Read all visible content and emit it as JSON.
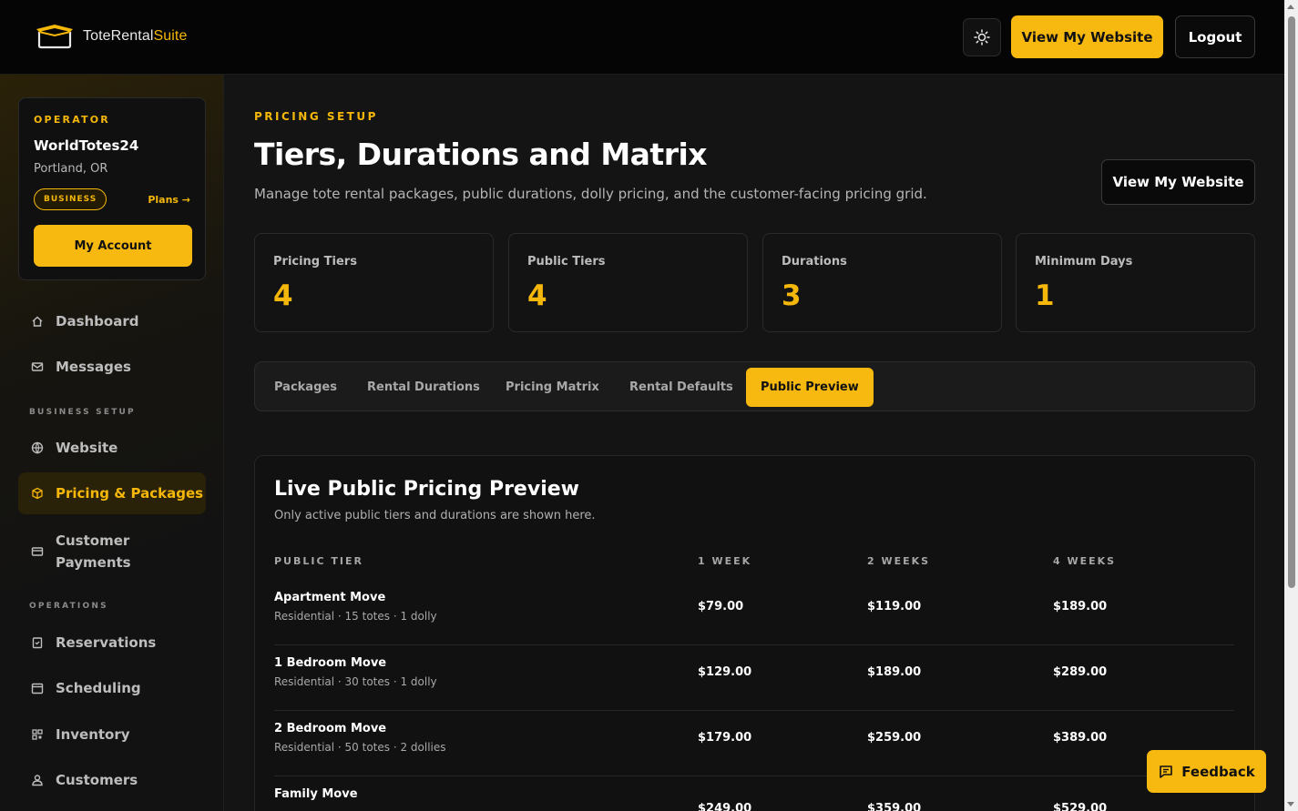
{
  "app": {
    "logo_text": "ToteRental",
    "logo_text_suite": "Suite"
  },
  "header": {
    "view_website": "View My Website",
    "logout": "Logout"
  },
  "operator": {
    "label": "OPERATOR",
    "name": "WorldTotes24",
    "location": "Portland, OR",
    "badge": "BUSINESS",
    "plans": "Plans →",
    "account_button": "My Account"
  },
  "nav": {
    "dashboard": "Dashboard",
    "messages": "Messages",
    "section_business": "BUSINESS SETUP",
    "website": "Website",
    "pricing": "Pricing & Packages",
    "payments_line1": "Customer",
    "payments_line2": "Payments",
    "section_operations": "OPERATIONS",
    "reservations": "Reservations",
    "scheduling": "Scheduling",
    "inventory": "Inventory",
    "customers": "Customers"
  },
  "page": {
    "eyebrow": "PRICING SETUP",
    "title": "Tiers, Durations and Matrix",
    "subtitle": "Manage tote rental packages, public durations, dolly pricing, and the customer-facing pricing grid.",
    "view_website": "View My Website"
  },
  "stats": [
    {
      "label": "Pricing Tiers",
      "value": "4"
    },
    {
      "label": "Public Tiers",
      "value": "4"
    },
    {
      "label": "Durations",
      "value": "3"
    },
    {
      "label": "Minimum Days",
      "value": "1"
    }
  ],
  "tabs": [
    {
      "label": "Packages"
    },
    {
      "label": "Rental Durations"
    },
    {
      "label": "Pricing Matrix"
    },
    {
      "label": "Rental Defaults"
    },
    {
      "label": "Public Preview",
      "active": true
    }
  ],
  "preview": {
    "title": "Live Public Pricing Preview",
    "subtitle": "Only active public tiers and durations are shown here.",
    "columns": [
      "PUBLIC TIER",
      "1 WEEK",
      "2 WEEKS",
      "4 WEEKS"
    ],
    "rows": [
      {
        "name": "Apartment Move",
        "desc": "Residential · 15 totes · 1 dolly",
        "prices": [
          "$79.00",
          "$119.00",
          "$189.00"
        ]
      },
      {
        "name": "1 Bedroom Move",
        "desc": "Residential · 30 totes · 1 dolly",
        "prices": [
          "$129.00",
          "$189.00",
          "$289.00"
        ]
      },
      {
        "name": "2 Bedroom Move",
        "desc": "Residential · 50 totes · 2 dollies",
        "prices": [
          "$179.00",
          "$259.00",
          "$389.00"
        ]
      },
      {
        "name": "Family Move",
        "desc": "",
        "prices": [
          "$249.00",
          "$359.00",
          "$529.00"
        ]
      }
    ]
  },
  "feedback": "Feedback",
  "colors": {
    "accent": "#f7b80f",
    "background": "#141414",
    "topbar": "#050505"
  }
}
